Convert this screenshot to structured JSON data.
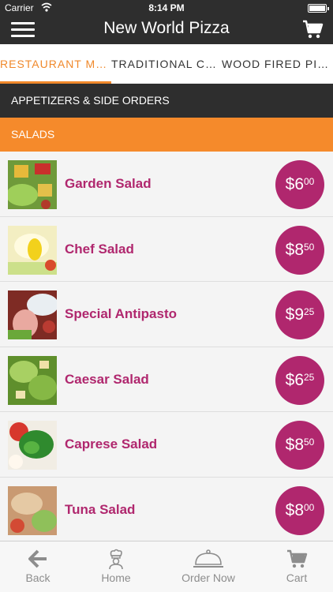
{
  "status_bar": {
    "carrier": "Carrier",
    "time": "8:14 PM"
  },
  "nav_bar": {
    "title": "New World Pizza"
  },
  "tabs": [
    {
      "label": "RESTAURANT MENU",
      "active": true
    },
    {
      "label": "TRADITIONAL CA...",
      "active": false
    },
    {
      "label": "WOOD FIRED PIZZ...",
      "active": false
    }
  ],
  "sections": {
    "appetizers": "APPETIZERS & SIDE ORDERS",
    "salads": "SALADS"
  },
  "menu_items": [
    {
      "name": "Garden Salad",
      "price_dollars": "$6",
      "price_cents": "00"
    },
    {
      "name": "Chef Salad",
      "price_dollars": "$8",
      "price_cents": "50"
    },
    {
      "name": "Special Antipasto",
      "price_dollars": "$9",
      "price_cents": "25"
    },
    {
      "name": "Caesar Salad",
      "price_dollars": "$6",
      "price_cents": "25"
    },
    {
      "name": "Caprese Salad",
      "price_dollars": "$8",
      "price_cents": "50"
    },
    {
      "name": "Tuna Salad",
      "price_dollars": "$8",
      "price_cents": "00"
    }
  ],
  "bottom_tabs": [
    {
      "label": "Back",
      "icon": "back-arrow-icon"
    },
    {
      "label": "Home",
      "icon": "chef-icon"
    },
    {
      "label": "Order Now",
      "icon": "serving-dish-icon"
    },
    {
      "label": "Cart",
      "icon": "cart-icon"
    }
  ],
  "colors": {
    "accent_orange": "#f58a2b",
    "brand_magenta": "#b0276e",
    "bar_dark": "#2e2e2e"
  }
}
